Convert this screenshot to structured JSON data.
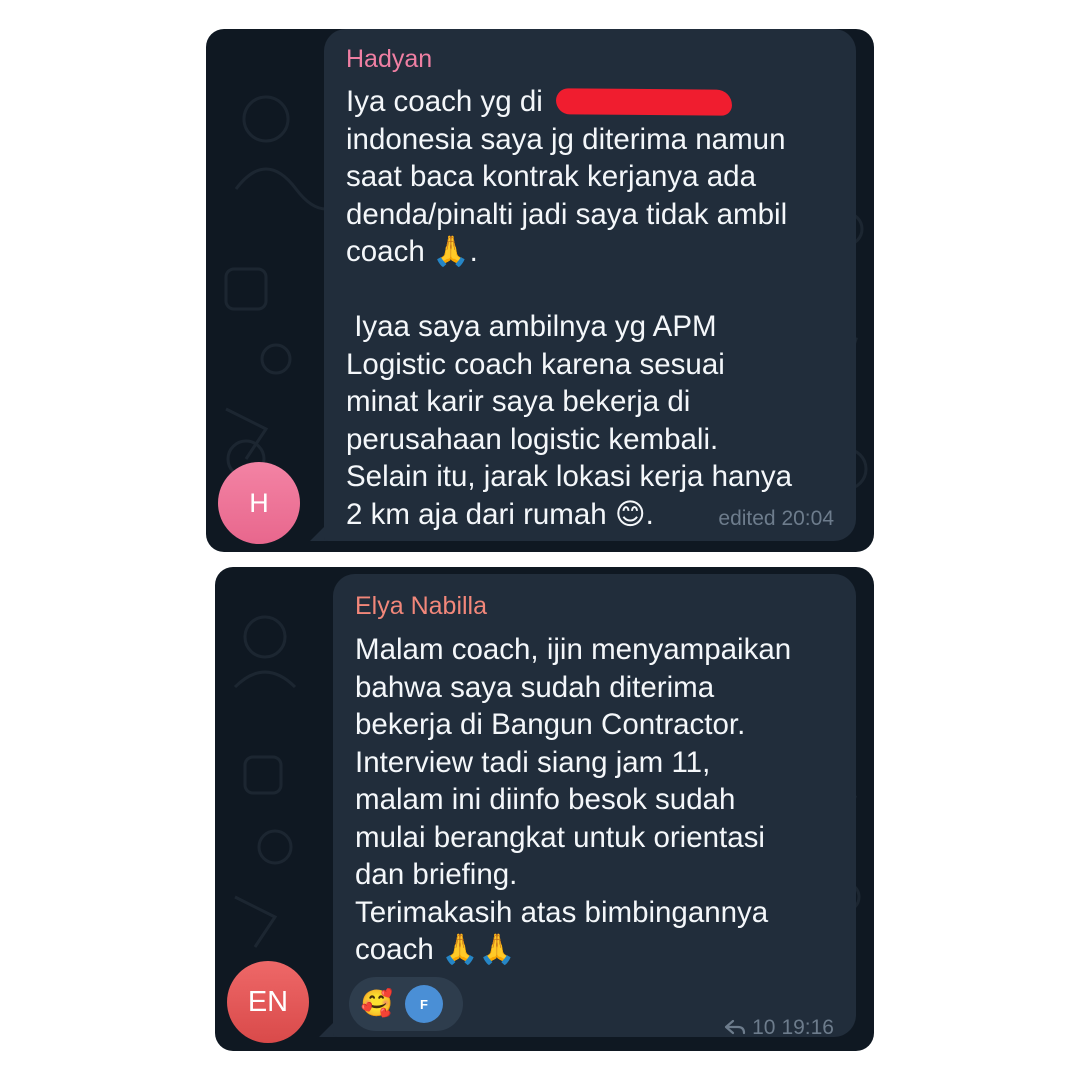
{
  "messages": [
    {
      "sender": "Hadyan",
      "avatar_initials": "H",
      "avatar_color": "#ec7197",
      "text": "Iya coach yg di ",
      "text_rest": "indonesia saya jg diterima namun\nsaat baca kontrak kerjanya ada\ndenda/pinalti jadi saya tidak ambil\ncoach 🙏.\n\n Iyaa saya ambilnya yg APM\nLogistic coach karena sesuai\nminat karir saya bekerja di\nperusahaan logistic kembali.\nSelain itu, jarak lokasi kerja hanya\n2 km aja dari rumah 😊.",
      "meta": "edited 20:04"
    },
    {
      "sender": "Elya Nabilla",
      "avatar_initials": "EN",
      "avatar_color": "#e35a5a",
      "text": "Malam coach, ijin menyampaikan\nbahwa saya sudah diterima\nbekerja di Bangun Contractor.\nInterview tadi siang jam 11,\nmalam ini diinfo besok sudah\nmulai berangkat untuk orientasi\ndan briefing.\nTerimakasih atas bimbingannya\ncoach 🙏🙏",
      "reactions": {
        "emoji": "🥰",
        "reactor_initial": "F"
      },
      "replies": "10",
      "time": "19:16"
    }
  ],
  "colors": {
    "background": "#0f1822",
    "bubble": "#212d3b",
    "text": "#f4f7fa",
    "meta": "#6d7c8c",
    "sender1": "#ef7fa3",
    "sender2": "#f2877a",
    "redaction": "#f01d2f"
  }
}
